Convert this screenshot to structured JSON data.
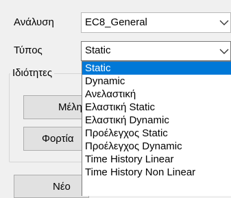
{
  "analysis": {
    "label": "Ανάλυση",
    "value": "EC8_General"
  },
  "type": {
    "label": "Τύπος",
    "value": "Static"
  },
  "properties_group": {
    "title": "Ιδιότητες"
  },
  "buttons": {
    "members": "Μέλη",
    "loads": "Φορτία",
    "new": "Νέο"
  },
  "dropdown": {
    "items": [
      "Static",
      "Dynamic",
      "Ανελαστική",
      "Ελαστική Static",
      "Ελαστική Dynamic",
      "Προέλεγχος Static",
      "Προέλεγχος Dynamic",
      "Time History Linear",
      "Time History Non Linear"
    ],
    "selected_index": 0
  },
  "colors": {
    "selection": "#0078d7",
    "window_bg": "#f0f0f0"
  }
}
